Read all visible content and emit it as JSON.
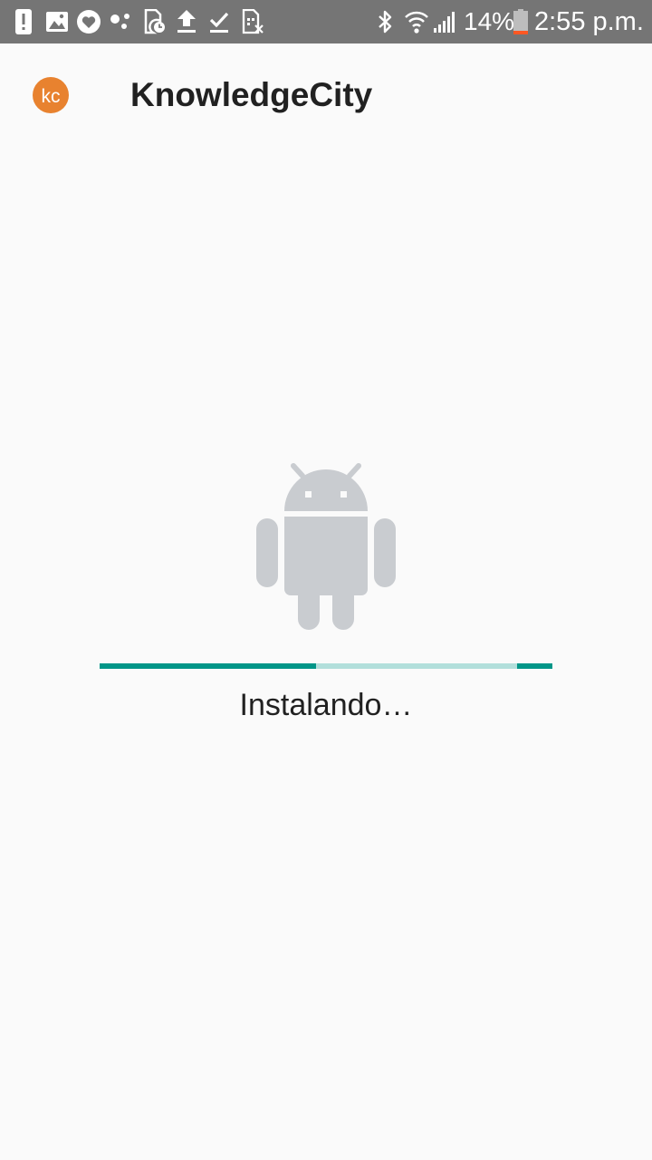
{
  "status_bar": {
    "notification_icons": [
      "alert-icon",
      "image-icon",
      "heart-badge-icon",
      "dots-icon",
      "file-clock-icon",
      "upload-icon",
      "download-done-icon",
      "sim-off-icon"
    ],
    "system_icons": [
      "bluetooth-icon",
      "wifi-icon",
      "signal-icon",
      "battery-icon"
    ],
    "battery": "14%",
    "time": "2:55 p.m."
  },
  "app_bar": {
    "logo_text": "kc",
    "title": "KnowledgeCity"
  },
  "main": {
    "illustration": "android-robot-icon",
    "progress": {
      "indeterminate": true,
      "segments": [
        {
          "start": 0.0,
          "end": 0.478
        },
        {
          "start": 0.922,
          "end": 1.0
        }
      ]
    },
    "status_text": "Instalando…"
  },
  "colors": {
    "status_bar": "#757575",
    "background": "#fafafa",
    "accent": "#009688",
    "track": "#b2dfdb",
    "robot": "#c9ccd0",
    "logo": "#e8822f"
  }
}
